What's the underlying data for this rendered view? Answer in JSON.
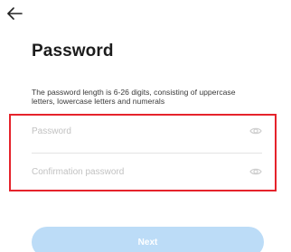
{
  "header": {
    "back_icon": "arrow-left-icon"
  },
  "title": "Password",
  "hint": "The password length is 6-26 digits, consisting of uppercase letters, lowercase letters and numerals",
  "form": {
    "password": {
      "value": "",
      "placeholder": "Password",
      "toggle_icon": "eye-icon"
    },
    "confirm_password": {
      "value": "",
      "placeholder": "Confirmation password",
      "toggle_icon": "eye-icon"
    },
    "highlight_color": "#e5232b"
  },
  "actions": {
    "next_label": "Next",
    "next_color": "#bcdcf7"
  }
}
